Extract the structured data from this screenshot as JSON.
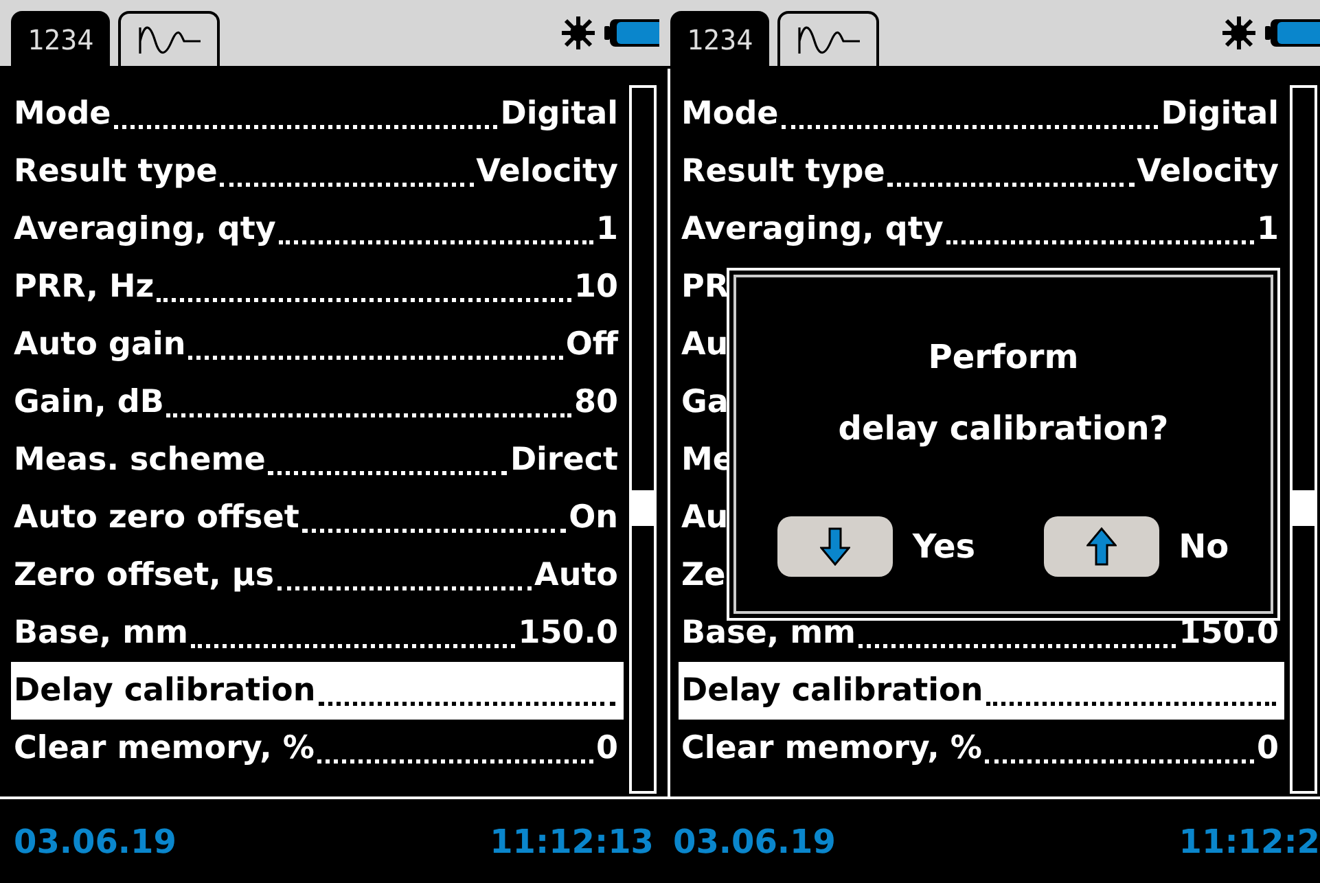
{
  "panels": [
    {
      "tabs": [
        {
          "kind": "text",
          "label": "1234",
          "selected": true
        },
        {
          "kind": "waveform",
          "selected": false
        }
      ],
      "rows": [
        {
          "label": "Mode",
          "value": "Digital",
          "selected": false
        },
        {
          "label": "Result type",
          "value": "Velocity",
          "selected": false
        },
        {
          "label": "Averaging, qty",
          "value": "1",
          "selected": false
        },
        {
          "label": "PRR, Hz",
          "value": "10",
          "selected": false
        },
        {
          "label": "Auto gain",
          "value": "Off",
          "selected": false
        },
        {
          "label": "Gain, dB",
          "value": "80",
          "selected": false
        },
        {
          "label": "Meas. scheme",
          "value": "Direct",
          "selected": false
        },
        {
          "label": "Auto zero offset",
          "value": "On",
          "selected": false
        },
        {
          "label": "Zero offset, µs",
          "value": "Auto",
          "selected": false
        },
        {
          "label": "Base, mm",
          "value": "150.0",
          "selected": false
        },
        {
          "label": "Delay calibration",
          "selected": true
        },
        {
          "label": "Clear memory, %",
          "value": "0",
          "selected": false
        }
      ],
      "date": "03.06.19",
      "time": "11:12:13"
    },
    {
      "tabs": [
        {
          "kind": "text",
          "label": "1234",
          "selected": true
        },
        {
          "kind": "waveform",
          "selected": false
        }
      ],
      "rows": [
        {
          "label": "Mode",
          "value": "Digital",
          "selected": false
        },
        {
          "label": "Result type",
          "value": "Velocity",
          "selected": false
        },
        {
          "label": "Averaging, qty",
          "value": "1",
          "selected": false
        },
        {
          "label": "PR",
          "selected": false
        },
        {
          "label": "Au",
          "selected": false
        },
        {
          "label": "Ga",
          "selected": false
        },
        {
          "label": "Me",
          "selected": false
        },
        {
          "label": "Au",
          "selected": false
        },
        {
          "label": "Ze",
          "selected": false
        },
        {
          "label": "Base, mm",
          "value": "150.0",
          "selected": false
        },
        {
          "label": "Delay calibration",
          "selected": true
        },
        {
          "label": "Clear memory, %",
          "value": "0",
          "selected": false
        }
      ],
      "dialog": {
        "message_lines": [
          "Perform",
          "delay calibration?"
        ],
        "buttons": [
          {
            "kind": "down",
            "label": "Yes"
          },
          {
            "kind": "up",
            "label": "No"
          }
        ]
      },
      "date": "03.06.19",
      "time": "11:12:2"
    }
  ]
}
